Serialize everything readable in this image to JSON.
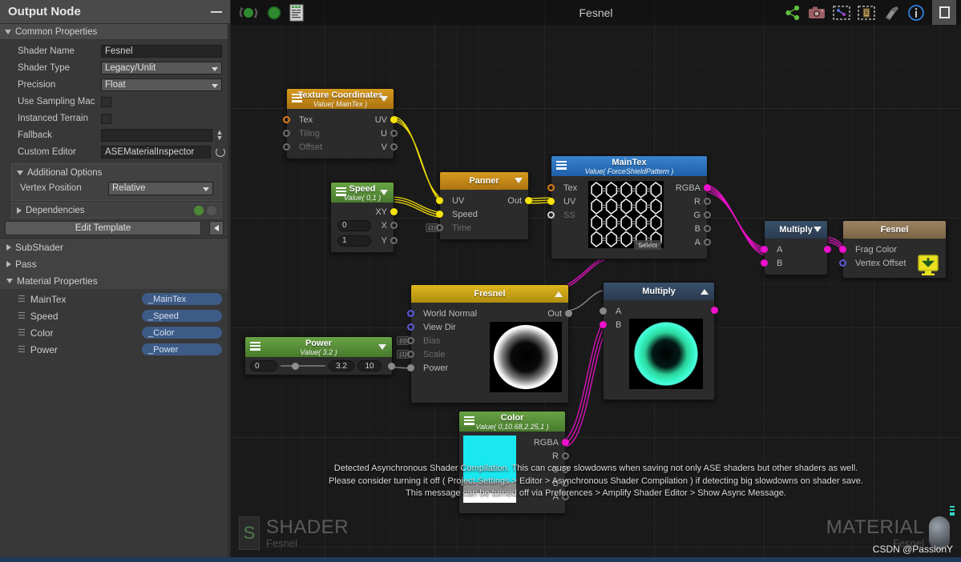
{
  "sidebar": {
    "title": "Output Node",
    "minimize_icon": "minimize-icon",
    "common_properties": {
      "label": "Common Properties",
      "fields": [
        {
          "label": "Shader Name",
          "value": "Fesnel",
          "type": "text"
        },
        {
          "label": "Shader Type",
          "value": "Legacy/Unlit",
          "type": "dropdown"
        },
        {
          "label": "Precision",
          "value": "Float",
          "type": "dropdown"
        },
        {
          "label": "Use Sampling Mac",
          "value": "",
          "type": "checkbox"
        },
        {
          "label": "Instanced Terrain",
          "value": "",
          "type": "checkbox"
        },
        {
          "label": "Fallback",
          "value": "",
          "type": "text-spinner"
        },
        {
          "label": "Custom Editor",
          "value": "ASEMaterialInspector",
          "type": "text-reload"
        }
      ]
    },
    "additional_options": {
      "label": "Additional Options",
      "fields": [
        {
          "label": "Vertex Position",
          "value": "Relative",
          "type": "dropdown"
        }
      ]
    },
    "dependencies": {
      "label": "Dependencies",
      "add_icon": "plus-circle-icon",
      "remove_icon": "minus-circle-icon"
    },
    "edit_template": "Edit Template",
    "tree": [
      {
        "label": "SubShader",
        "expanded": false
      },
      {
        "label": "Pass",
        "expanded": false
      },
      {
        "label": "Material Properties",
        "expanded": true
      }
    ],
    "material_properties": [
      {
        "name": "MainTex",
        "ref": "_MainTex"
      },
      {
        "name": "Speed",
        "ref": "_Speed"
      },
      {
        "name": "Color",
        "ref": "_Color"
      },
      {
        "name": "Power",
        "ref": "_Power"
      }
    ]
  },
  "toolbar": {
    "title": "Fesnel",
    "left_icons": [
      {
        "name": "live-update-icon"
      },
      {
        "name": "compile-sphere-icon"
      },
      {
        "name": "shader-code-icon"
      }
    ],
    "right_icons": [
      {
        "name": "share-icon"
      },
      {
        "name": "camera-icon"
      },
      {
        "name": "focus-selection-icon"
      },
      {
        "name": "focus-node-icon"
      },
      {
        "name": "clean-unused-icon"
      },
      {
        "name": "info-icon"
      }
    ],
    "maximize_icon": "maximize-icon"
  },
  "nodes": {
    "texture_coordinates": {
      "title": "Texture Coordinates",
      "subtitle": "Value( MainTex )",
      "inputs": [
        {
          "label": "Tex",
          "dot": "orange",
          "dim": false
        },
        {
          "label": "Tiling",
          "dot": "empty",
          "dim": true
        },
        {
          "label": "Offset",
          "dot": "empty",
          "dim": true
        }
      ],
      "outputs": [
        {
          "label": "UV",
          "dot": "yellow"
        },
        {
          "label": "U",
          "dot": "empty"
        },
        {
          "label": "V",
          "dot": "empty"
        }
      ]
    },
    "speed": {
      "title": "Speed",
      "subtitle": "Value( 0,1 )",
      "outputs": [
        {
          "label": "XY",
          "dot": "yellow"
        },
        {
          "label": "X",
          "dot": "empty"
        },
        {
          "label": "Y",
          "dot": "empty"
        }
      ],
      "values": [
        "0",
        "1"
      ]
    },
    "panner": {
      "title": "Panner",
      "inputs": [
        {
          "label": "UV",
          "dot": "yellow",
          "dim": false
        },
        {
          "label": "Speed",
          "dot": "yellow",
          "dim": false
        },
        {
          "label": "Time",
          "dot": "empty",
          "dim": true
        }
      ],
      "outputs": [
        {
          "label": "Out",
          "dot": "yellow"
        }
      ],
      "badge": "(1)"
    },
    "maintex": {
      "title": "MainTex",
      "subtitle": "Value( ForceShieldPattern )",
      "inputs": [
        {
          "label": "Tex",
          "dot": "orange",
          "dim": false
        },
        {
          "label": "UV",
          "dot": "yellow",
          "dim": false
        },
        {
          "label": "SS",
          "dot": "white",
          "dim": true
        }
      ],
      "outputs": [
        {
          "label": "RGBA",
          "dot": "magenta"
        },
        {
          "label": "R",
          "dot": "empty"
        },
        {
          "label": "G",
          "dot": "empty"
        },
        {
          "label": "B",
          "dot": "empty"
        },
        {
          "label": "A",
          "dot": "empty"
        }
      ],
      "select_button": "Select"
    },
    "fresnel": {
      "title": "Fresnel",
      "inputs": [
        {
          "label": "World Normal",
          "dot": "blue",
          "dim": false,
          "badge": ""
        },
        {
          "label": "View Dir",
          "dot": "blue",
          "dim": false,
          "badge": ""
        },
        {
          "label": "Bias",
          "dot": "empty",
          "dim": true,
          "badge": "(0)"
        },
        {
          "label": "Scale",
          "dot": "empty",
          "dim": true,
          "badge": "(1)"
        },
        {
          "label": "Power",
          "dot": "grey",
          "dim": false,
          "badge": ""
        }
      ],
      "outputs": [
        {
          "label": "Out",
          "dot": "grey"
        }
      ]
    },
    "power": {
      "title": "Power",
      "subtitle": "Value( 3.2 )",
      "min": "0",
      "value": "3.2",
      "max": "10"
    },
    "multiply_b": {
      "title": "Multiply",
      "inputs": [
        {
          "label": "A",
          "dot": "grey"
        },
        {
          "label": "B",
          "dot": "magenta"
        }
      ]
    },
    "multiply_a": {
      "title": "Multiply",
      "inputs": [
        {
          "label": "A",
          "dot": "magenta"
        },
        {
          "label": "B",
          "dot": "magenta"
        }
      ]
    },
    "color": {
      "title": "Color",
      "subtitle": "Value( 0,10.68,2.25,1 )",
      "swatch": "#19E8F0",
      "outputs": [
        {
          "label": "RGBA",
          "dot": "magenta"
        },
        {
          "label": "R",
          "dot": "empty"
        },
        {
          "label": "G",
          "dot": "empty"
        },
        {
          "label": "B",
          "dot": "empty"
        },
        {
          "label": "A",
          "dot": "empty"
        }
      ]
    },
    "output": {
      "title": "Fesnel",
      "inputs": [
        {
          "label": "Frag Color",
          "dot": "magenta"
        },
        {
          "label": "Vertex Offset",
          "dot": "blue"
        }
      ],
      "vertex_icon": "vertex-download-icon"
    }
  },
  "warning": {
    "line1": "Detected Asynchronous Shader Compilation. This can cause slowdowns when saving not only ASE shaders but other shaders as well.",
    "line2": "Please consider turning it off ( Project Settings > Editor > Asynchronous Shader Compilation ) if detecting big slowdowns on shader save.",
    "line3": "This message can be turned off via Preferences > Amplify Shader Editor > Show Async Message."
  },
  "watermarks": {
    "shader_label": "SHADER",
    "shader_name": "Fesnel",
    "shader_icon": "S",
    "material_label": "MATERIAL",
    "material_name": "Fesnel",
    "credit": "CSDN @PassionY"
  },
  "colors": {
    "node_orange": "#c07f17",
    "node_green": "#4b8a35",
    "node_blue": "#2e6fb8",
    "node_gold": "#c8a318",
    "node_dark": "#2e3a4a",
    "node_tan": "#8a7355",
    "wire_yellow": "#f5e20a",
    "wire_magenta": "#ee11cc"
  }
}
